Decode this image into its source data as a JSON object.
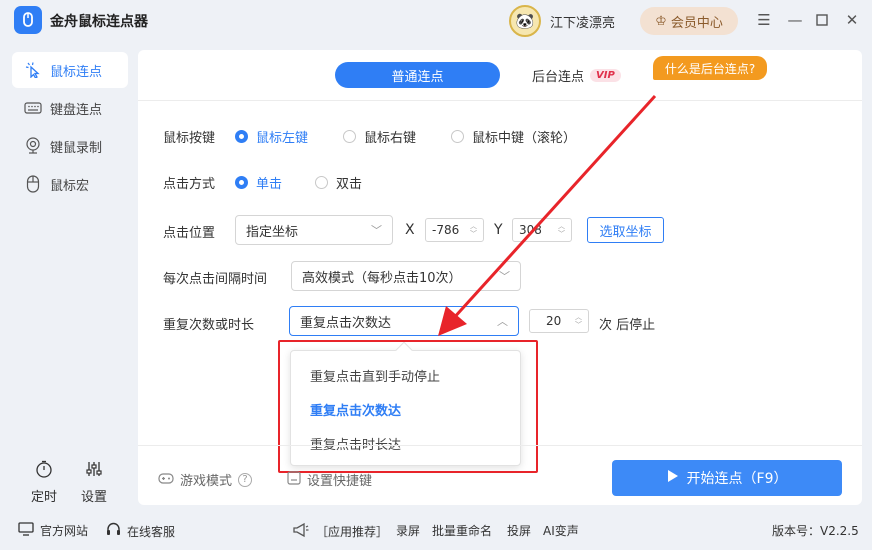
{
  "app": {
    "title": "金舟鼠标连点器"
  },
  "user": {
    "name": "江下凌漂亮",
    "vip_label": "会员中心"
  },
  "window_controls": [
    "menu",
    "minimize",
    "maximize",
    "close"
  ],
  "sidebar": {
    "items": [
      {
        "label": "鼠标连点",
        "icon": "cursor-click-icon",
        "active": true
      },
      {
        "label": "键盘连点",
        "icon": "keyboard-icon",
        "active": false
      },
      {
        "label": "键鼠录制",
        "icon": "record-icon",
        "active": false
      },
      {
        "label": "鼠标宏",
        "icon": "mouse-icon",
        "active": false
      }
    ],
    "bottom": [
      {
        "label": "定时",
        "icon": "timer-icon"
      },
      {
        "label": "设置",
        "icon": "settings-sliders-icon"
      }
    ]
  },
  "tabs": {
    "normal": "普通连点",
    "background": "后台连点",
    "vip_badge": "VIP",
    "help_tag": "什么是后台连点?"
  },
  "form": {
    "mouse_button": {
      "label": "鼠标按键",
      "options": [
        "鼠标左键",
        "鼠标右键",
        "鼠标中键（滚轮）"
      ],
      "selected": 0
    },
    "click_type": {
      "label": "点击方式",
      "options": [
        "单击",
        "双击"
      ],
      "selected": 0
    },
    "position": {
      "label": "点击位置",
      "mode": "指定坐标",
      "x_label": "X",
      "x_value": "-786",
      "y_label": "Y",
      "y_value": "308",
      "pick_button": "选取坐标"
    },
    "interval": {
      "label": "每次点击间隔时间",
      "value": "高效模式（每秒点击10次）"
    },
    "repeat": {
      "label": "重复次数或时长",
      "value": "重复点击次数达",
      "count": "20",
      "suffix": "次 后停止"
    }
  },
  "dropdown": {
    "options": [
      "重复点击直到手动停止",
      "重复点击次数达",
      "重复点击时长达"
    ],
    "selected": 1
  },
  "bottom_bar": {
    "game_mode": "游戏模式",
    "shortcut": "设置快捷键",
    "start_button": "开始连点（F9）"
  },
  "status_bar": {
    "website": "官方网站",
    "support": "在线客服",
    "recommend": "［应用推荐］",
    "apps": [
      "录屏",
      "批量重命名",
      "投屏",
      "AI变声"
    ],
    "version": "版本号：V2.2.5"
  },
  "colors": {
    "accent": "#2f7ef5",
    "highlight_box": "#e8242a",
    "help_tag": "#f39a1f"
  }
}
